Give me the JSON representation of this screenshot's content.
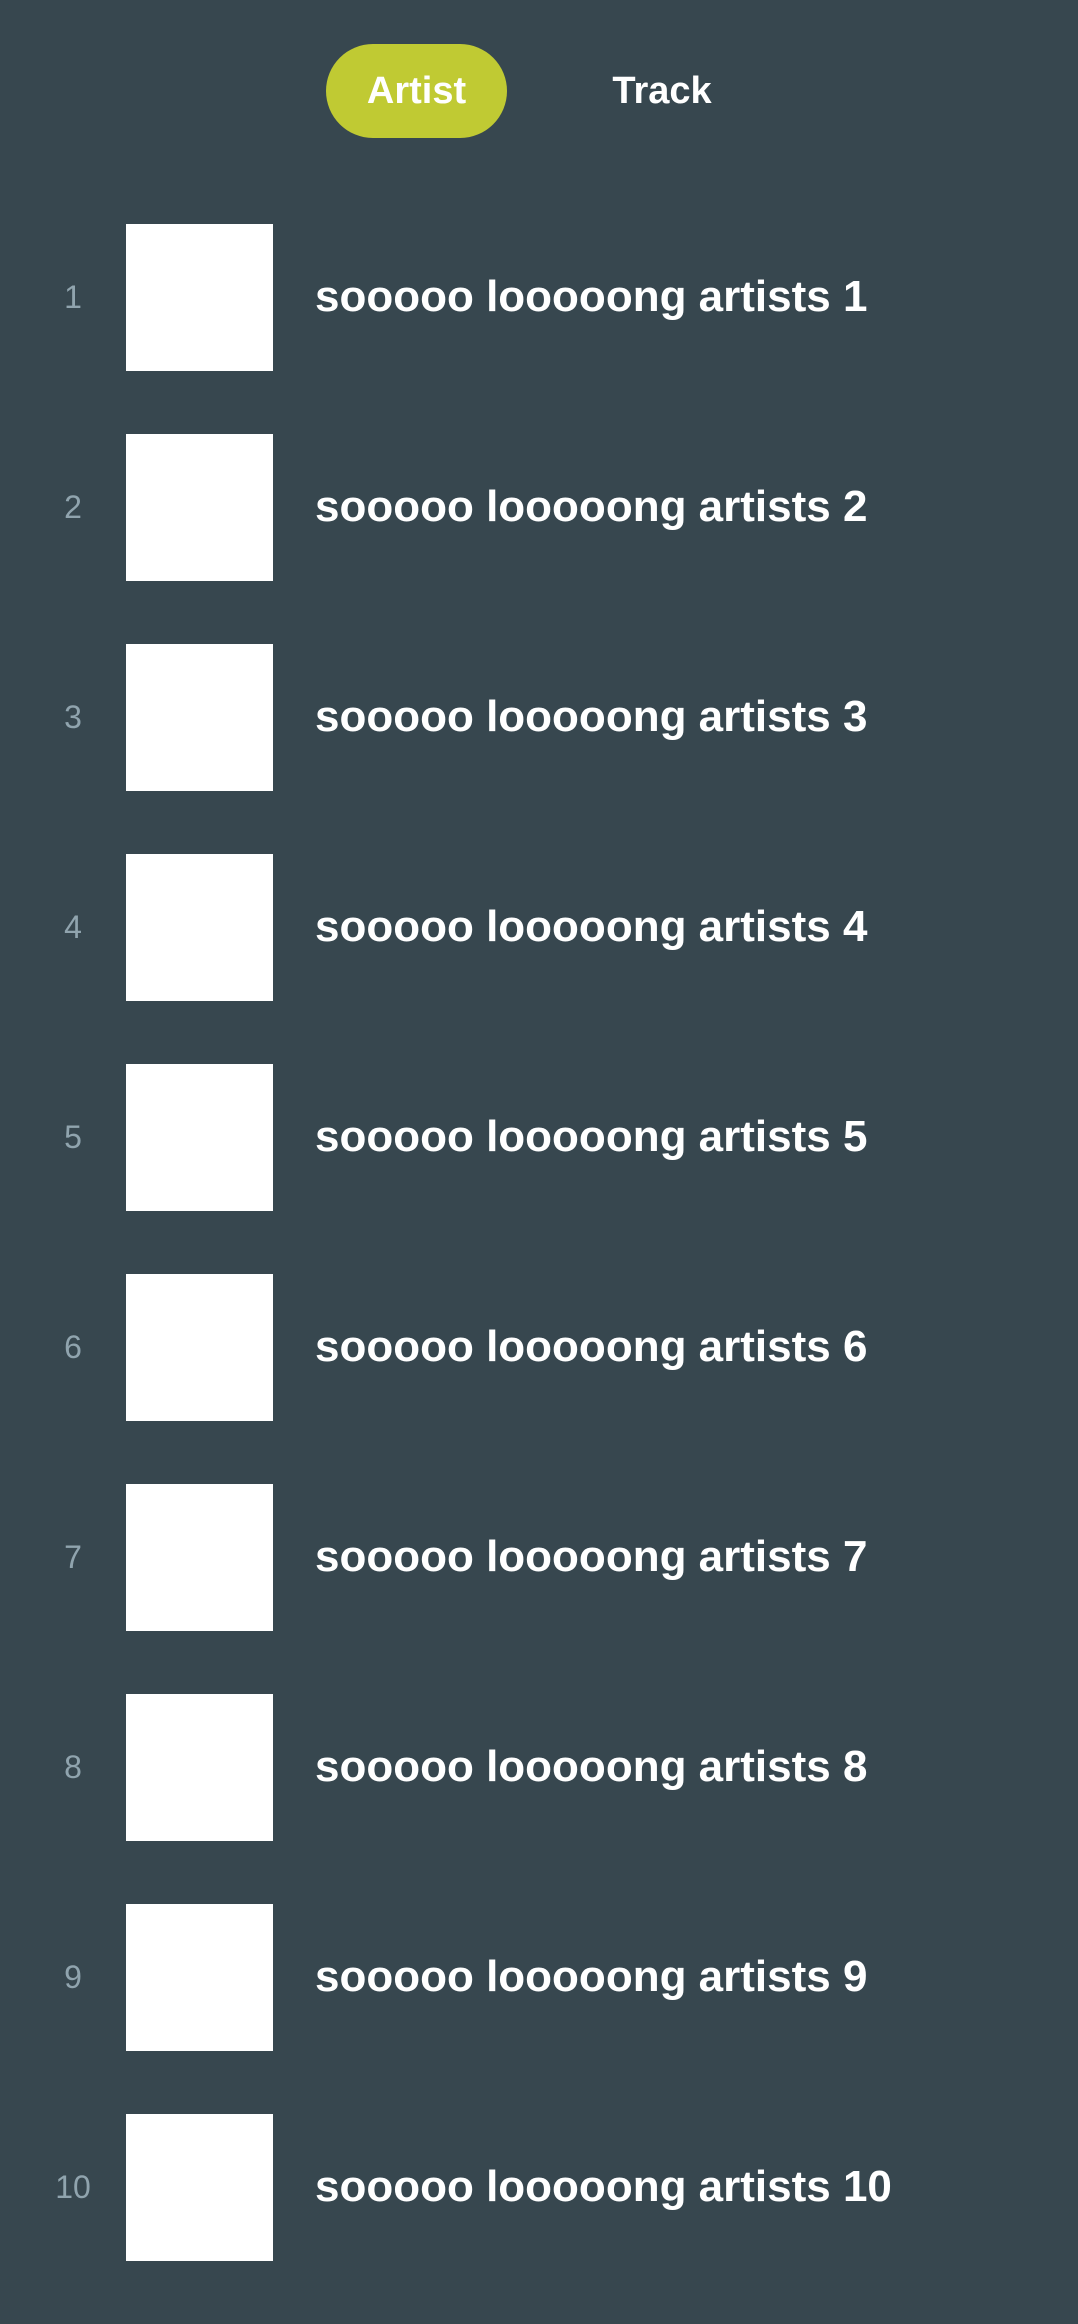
{
  "tabs": {
    "artist_label": "Artist",
    "track_label": "Track",
    "active": "Artist"
  },
  "colors": {
    "background": "#37474f",
    "accent": "#c0ca33",
    "rank_text": "#90a4ae",
    "thumbnail": "#ffffff"
  },
  "list": {
    "items": [
      {
        "rank": "1",
        "name": "sooooo looooong artists 1"
      },
      {
        "rank": "2",
        "name": "sooooo looooong artists 2"
      },
      {
        "rank": "3",
        "name": "sooooo looooong artists 3"
      },
      {
        "rank": "4",
        "name": "sooooo looooong artists 4"
      },
      {
        "rank": "5",
        "name": "sooooo looooong artists 5"
      },
      {
        "rank": "6",
        "name": "sooooo looooong artists 6"
      },
      {
        "rank": "7",
        "name": "sooooo looooong artists 7"
      },
      {
        "rank": "8",
        "name": "sooooo looooong artists 8"
      },
      {
        "rank": "9",
        "name": "sooooo looooong artists 9"
      },
      {
        "rank": "10",
        "name": "sooooo looooong artists 10"
      }
    ]
  }
}
